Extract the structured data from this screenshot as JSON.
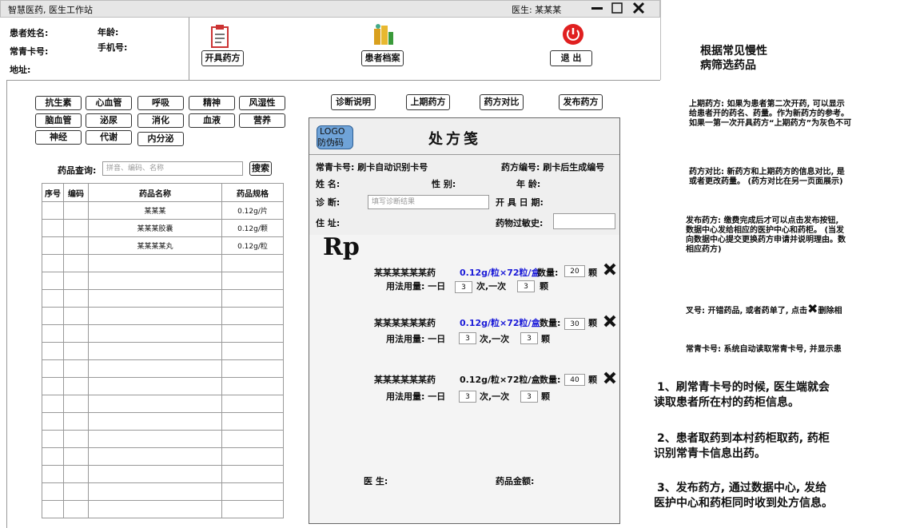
{
  "window": {
    "title": "智慧医药, 医生工作站",
    "doctor_label": "医生: 某某某"
  },
  "patient": {
    "name_label": "患者姓名:",
    "age_label": "年龄:",
    "card_label": "常青卡号:",
    "phone_label": "手机号:",
    "address_label": "地址:"
  },
  "toolbar": {
    "prescribe": "开具药方",
    "records": "患者档案",
    "exit": "退 出"
  },
  "categories": [
    "抗生素",
    "心血管",
    "呼吸",
    "精神",
    "风湿性",
    "脑血管",
    "泌尿",
    "消化",
    "血液",
    "营养",
    "神经",
    "代谢",
    "内分泌"
  ],
  "search": {
    "label": "药品查询:",
    "placeholder": "拼音、编码、名称",
    "button": "搜索"
  },
  "table": {
    "headers": [
      "序号",
      "编码",
      "药品名称",
      "药品规格"
    ],
    "rows": [
      {
        "name": "某某某",
        "spec": "0.12g/片"
      },
      {
        "name": "某某某胶囊",
        "spec": "0.12g/颗"
      },
      {
        "name": "某某某某丸",
        "spec": "0.12g/粒"
      }
    ]
  },
  "actions": {
    "diagnosis": "诊断说明",
    "last": "上期药方",
    "compare": "药方对比",
    "publish": "发布药方"
  },
  "rx": {
    "logo_line1": "LOGO",
    "logo_line2": "防伪码",
    "title": "处方笺",
    "card": "常青卡号: 刷卡自动识别卡号",
    "rx_no": "药方编号: 刷卡后生成编号",
    "name": "姓 名:",
    "gender": "性 别:",
    "age": "年 龄:",
    "diagnosis": "诊 断:",
    "diagnosis_placeholder": "填写诊断结果",
    "date": "开 具 日 期:",
    "address": "住 址:",
    "allergy": "药物过敏史:",
    "rp": "Rp",
    "items": [
      {
        "name": "某某某某某某药",
        "spec": "0.12g/粒×72粒/盒",
        "qty_label": "数量:",
        "qty": "20",
        "unit": "颗",
        "usage": "用法用量: 一日",
        "times": "3",
        "per": "次,一次",
        "dose": "3",
        "dose_unit": "颗"
      },
      {
        "name": "某某某某某某药",
        "spec": "0.12g/粒×72粒/盒",
        "qty_label": "数量:",
        "qty": "30",
        "unit": "颗",
        "usage": "用法用量: 一日",
        "times": "3",
        "per": "次,一次",
        "dose": "3",
        "dose_unit": "颗"
      },
      {
        "name": "某某某某某某药",
        "spec": "0.12g/粒×72粒/盒",
        "qty_label": "数量:",
        "qty": "40",
        "unit": "颗",
        "usage": "用法用量: 一日",
        "times": "3",
        "per": "次,一次",
        "dose": "3",
        "dose_unit": "颗"
      }
    ],
    "doctor": "医 生:",
    "amount": "药品金额:"
  },
  "notes": {
    "heading1": "根据常见慢性",
    "heading2": "病筛选药品",
    "last1": "上期药方: 如果为患者第二次开药, 可以显示",
    "last2": "给患者开的药名、药量。作为新药方的参考。",
    "last3": "如果一第一次开具药方“上期药方”为灰色不可",
    "cmp1": "药方对比: 新药方和上期药方的信息对比, 是",
    "cmp2": "或者更改药量。 (药方对比在另一页面展示)",
    "pub1": "发布药方: 缴费完成后才可以点击发布按钮, ",
    "pub2": "数据中心发给相应的医护中心和药柜。 (当发",
    "pub3": "向数据中心提交更换药方申请并说明理由。数",
    "pub4": "相应药方)",
    "x_note_a": "叉号: 开错药品, 或者药单了, 点击",
    "x_note_b": "删除相",
    "card_note": "常青卡号: 系统自动读取常青卡号, 并显示患",
    "p1a": "1、刷常青卡号的时候, 医生端就会",
    "p1b": "读取患者所在村的药柜信息。",
    "p2a": "2、患者取药到本村药柜取药, 药柜",
    "p2b": "识别常青卡信息出药。",
    "p3a": "3、发布药方, 通过数据中心, 发给",
    "p3b": "医护中心和药柜同时收到处方信息。"
  },
  "colors": {
    "accent_blue": "#1a1ad8",
    "exit_red": "#e02020"
  }
}
